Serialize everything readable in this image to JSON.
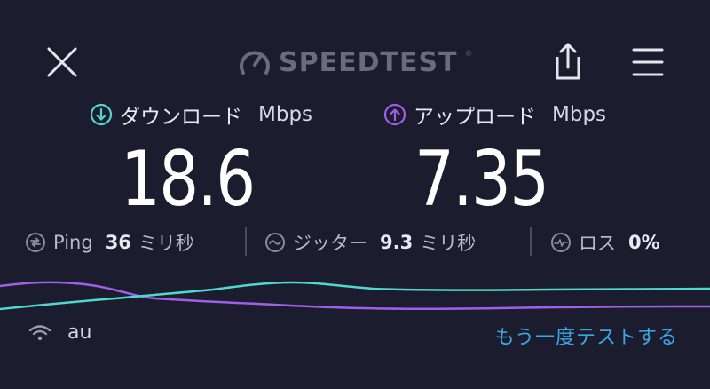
{
  "header": {
    "logo_text": "SPEEDTEST",
    "logo_mark": "®",
    "icons": {
      "close": "close-icon",
      "gauge": "gauge-icon",
      "share": "share-icon",
      "menu": "hamburger-menu-icon"
    }
  },
  "download": {
    "label": "ダウンロード",
    "unit": "Mbps",
    "value": "18.6",
    "accent": "#4fd8cd"
  },
  "upload": {
    "label": "アップロード",
    "unit": "Mbps",
    "value": "7.35",
    "accent": "#a05fe8"
  },
  "stats": {
    "ping": {
      "name": "Ping",
      "value": "36",
      "unit": "ミリ秒"
    },
    "jitter": {
      "name": "ジッター",
      "value": "9.3",
      "unit": "ミリ秒"
    },
    "loss": {
      "name": "ロス",
      "value": "0%"
    }
  },
  "footer": {
    "carrier": "au",
    "retest": "もう一度テストする",
    "retest_color": "#3aa7e6"
  }
}
